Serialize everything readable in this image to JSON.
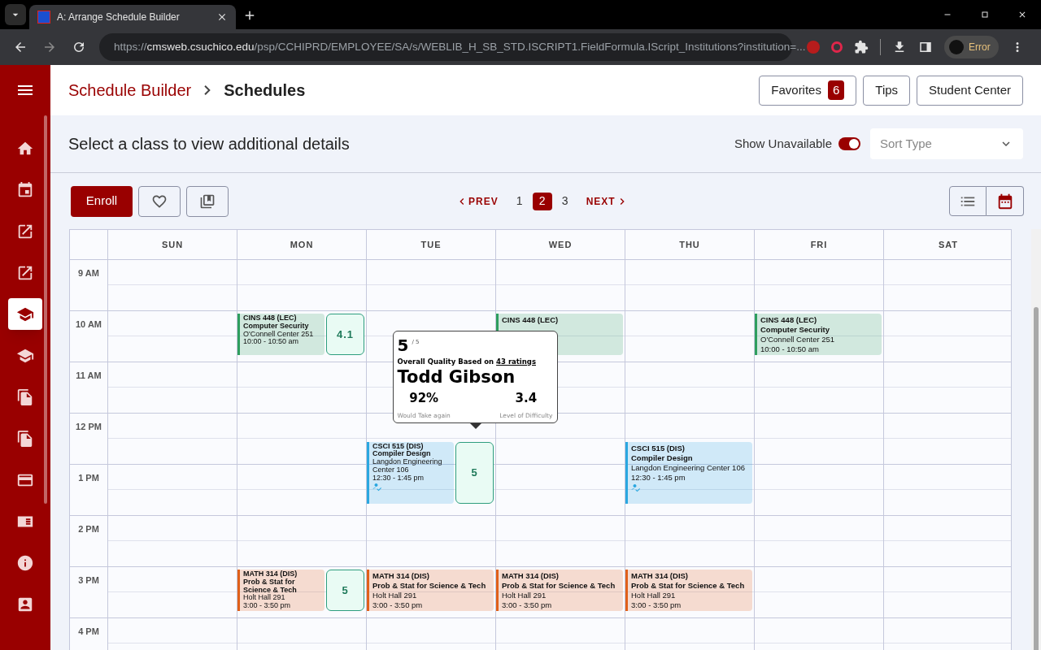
{
  "browser": {
    "tab_title": "A: Arrange Schedule Builder",
    "url_scheme": "https://",
    "url_host": "cmsweb.csuchico.edu",
    "url_rest": "/psp/CCHIPRD/EMPLOYEE/SA/s/WEBLIB_H_SB_STD.ISCRIPT1.FieldFormula.IScript_Institutions?institution=...",
    "profile": "Error"
  },
  "sidebar": {
    "items": [
      {
        "kind": "home",
        "selected": false
      },
      {
        "kind": "calendar",
        "selected": false
      },
      {
        "kind": "external",
        "selected": false
      },
      {
        "kind": "external",
        "selected": false
      },
      {
        "kind": "school",
        "selected": true
      },
      {
        "kind": "school",
        "selected": false
      },
      {
        "kind": "files",
        "selected": false
      },
      {
        "kind": "files",
        "selected": false
      },
      {
        "kind": "card",
        "selected": false
      },
      {
        "kind": "news",
        "selected": false
      },
      {
        "kind": "info",
        "selected": false
      },
      {
        "kind": "contact",
        "selected": false
      }
    ]
  },
  "header": {
    "breadcrumb": [
      "Schedule Builder",
      "Schedules"
    ],
    "buttons": [
      {
        "label": "Favorites",
        "badge": "6"
      },
      {
        "label": "Tips"
      },
      {
        "label": "Student Center"
      }
    ]
  },
  "subheader": {
    "title": "Select a class to view additional details",
    "toggle": {
      "label": "Show Unavailable",
      "on": true
    },
    "sort": {
      "placeholder": "Sort Type"
    }
  },
  "toolbar": {
    "enroll": "Enroll",
    "prev": "PREV",
    "next": "NEXT",
    "pages": [
      {
        "label": "1",
        "selected": false
      },
      {
        "label": "2",
        "selected": true
      },
      {
        "label": "3",
        "selected": false
      }
    ],
    "views": [
      {
        "kind": "list",
        "selected": false
      },
      {
        "kind": "calendar",
        "selected": true
      }
    ]
  },
  "calendar": {
    "hours": [
      "9 AM",
      "10 AM",
      "11 AM",
      "12 PM",
      "1 PM",
      "2 PM",
      "3 PM",
      "4 PM"
    ],
    "days": [
      {
        "label": "SUN"
      },
      {
        "label": "MON",
        "events": [
          {
            "code": "CINS 448 (LEC)",
            "title": "Computer Security",
            "room": "O'Connell Center 251",
            "time": "10:00 - 10:50 am",
            "color": "#2e9e5e",
            "rating": "4.1"
          },
          {
            "code": "MATH 314 (DIS)",
            "title": "Prob & Stat for Science & Tech",
            "room": "Holt Hall 291",
            "time": "3:00 - 3:50 pm",
            "color": "#e0601a",
            "rating": "5"
          }
        ]
      },
      {
        "label": "TUE",
        "events": [
          {
            "code": "CSCI 515 (DIS)",
            "title": "Compiler Design",
            "room": "Langdon Engineering Center 106",
            "time": "12:30 - 1:45 pm",
            "color": "#2aa7e0",
            "instructor_icon": true,
            "rating": "5",
            "popup": {
              "score": "5",
              "out_of": "/ 5",
              "based_on": "Overall Quality Based on",
              "ratings_link": "43 ratings",
              "name": "Todd Gibson",
              "stats": [
                {
                  "value": "92%",
                  "label": "Would Take again"
                },
                {
                  "value": "3.4",
                  "label": "Level of Difficulty"
                }
              ]
            }
          },
          {
            "code": "MATH 314 (DIS)",
            "title": "Prob & Stat for Science & Tech",
            "room": "Holt Hall 291",
            "time": "3:00 - 3:50 pm",
            "color": "#e0601a"
          }
        ]
      },
      {
        "label": "WED",
        "events": [
          {
            "code": "CINS 448 (LEC)",
            "color": "#2e9e5e"
          },
          {
            "code": "MATH 314 (DIS)",
            "title": "Prob & Stat for Science & Tech",
            "room": "Holt Hall 291",
            "time": "3:00 - 3:50 pm",
            "color": "#e0601a"
          }
        ]
      },
      {
        "label": "THU",
        "events": [
          {
            "code": "CSCI 515 (DIS)",
            "title": "Compiler Design",
            "room": "Langdon Engineering Center 106",
            "time": "12:30 - 1:45 pm",
            "color": "#2aa7e0",
            "instructor_icon": true
          },
          {
            "code": "MATH 314 (DIS)",
            "title": "Prob & Stat for Science & Tech",
            "room": "Holt Hall 291",
            "time": "3:00 - 3:50 pm",
            "color": "#e0601a"
          }
        ]
      },
      {
        "label": "FRI",
        "events": [
          {
            "code": "CINS 448 (LEC)",
            "title": "Computer Security",
            "room": "O'Connell Center 251",
            "time": "10:00 - 10:50 am",
            "color": "#2e9e5e"
          }
        ]
      },
      {
        "label": "SAT"
      }
    ]
  }
}
